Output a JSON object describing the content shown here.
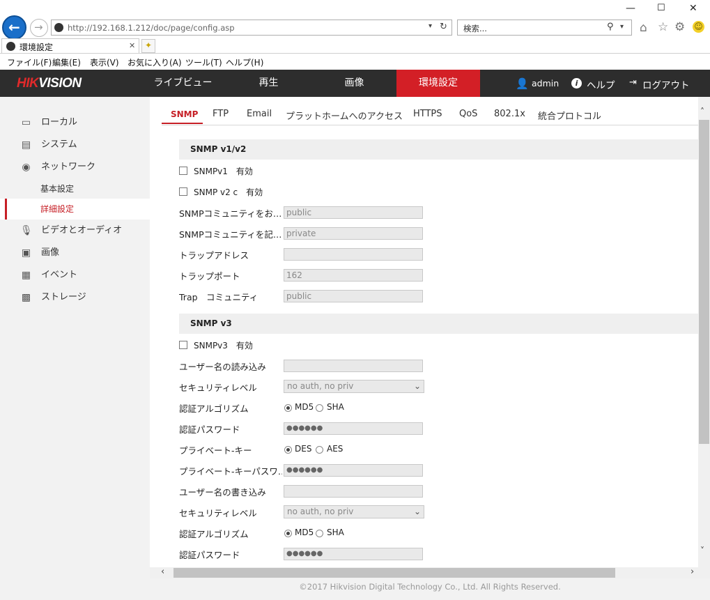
{
  "browser": {
    "url": "http://192.168.1.212/doc/page/config.asp",
    "search_placeholder": "検索...",
    "tab_title": "環境設定",
    "menu": [
      "ファイル(F)",
      "編集(E)",
      "表示(V)",
      "お気に入り(A)",
      "ツール(T)",
      "ヘルプ(H)"
    ]
  },
  "app": {
    "logo_red": "HIK",
    "logo_white": "VISION",
    "nav": [
      "ライブビュー",
      "再生",
      "画像",
      "環境設定"
    ],
    "user": "admin",
    "help": "ヘルプ",
    "logout": "ログアウト"
  },
  "sidebar": {
    "items": [
      {
        "label": "ローカル",
        "icon": "monitor-icon"
      },
      {
        "label": "システム",
        "icon": "window-icon"
      },
      {
        "label": "ネットワーク",
        "icon": "globe-icon"
      },
      {
        "label": "基本設定"
      },
      {
        "label": "詳細設定"
      },
      {
        "label": "ビデオとオーディオ",
        "icon": "mic-icon"
      },
      {
        "label": "画像",
        "icon": "image-icon"
      },
      {
        "label": "イベント",
        "icon": "calendar-icon"
      },
      {
        "label": "ストレージ",
        "icon": "save-icon"
      }
    ]
  },
  "subtabs": [
    "SNMP",
    "FTP",
    "Email",
    "プラットホームへのアクセス",
    "HTTPS",
    "QoS",
    "802.1x",
    "統合プロトコル"
  ],
  "v12": {
    "title": "SNMP v1/v2",
    "v1": "SNMPv1　有効",
    "v2": "SNMP v2 c　有効",
    "read_label": "SNMPコミュニティをお…",
    "read_value": "public",
    "write_label": "SNMPコミュニティを記…",
    "write_value": "private",
    "trap_addr_label": "トラップアドレス",
    "trap_addr_value": "",
    "trap_port_label": "トラップポート",
    "trap_port_value": "162",
    "trap_comm_label": "Trap　コミュニティ",
    "trap_comm_value": "public"
  },
  "v3": {
    "title": "SNMP v3",
    "enable": "SNMPv3　有効",
    "read_user_label": "ユーザー名の読み込み",
    "read_user_value": "",
    "sec_label": "セキュリティレベル",
    "sec_value": "no auth, no priv",
    "auth_label": "認証アルゴリズム",
    "md5": "MD5",
    "sha": "SHA",
    "auth_pwd_label": "認証パスワード",
    "pwd_mask": "●●●●●●",
    "priv_label": "プライベート-キー",
    "des": "DES",
    "aes": "AES",
    "priv_pwd_label": "プライベート-キーパスワ…",
    "write_user_label": "ユーザー名の書き込み",
    "write_user_value": "",
    "sec2_label": "セキュリティレベル",
    "sec2_value": "no auth, no priv",
    "auth2_label": "認証アルゴリズム",
    "auth2_pwd_label": "認証パスワード"
  },
  "footer": "©2017 Hikvision Digital Technology Co., Ltd. All Rights Reserved."
}
